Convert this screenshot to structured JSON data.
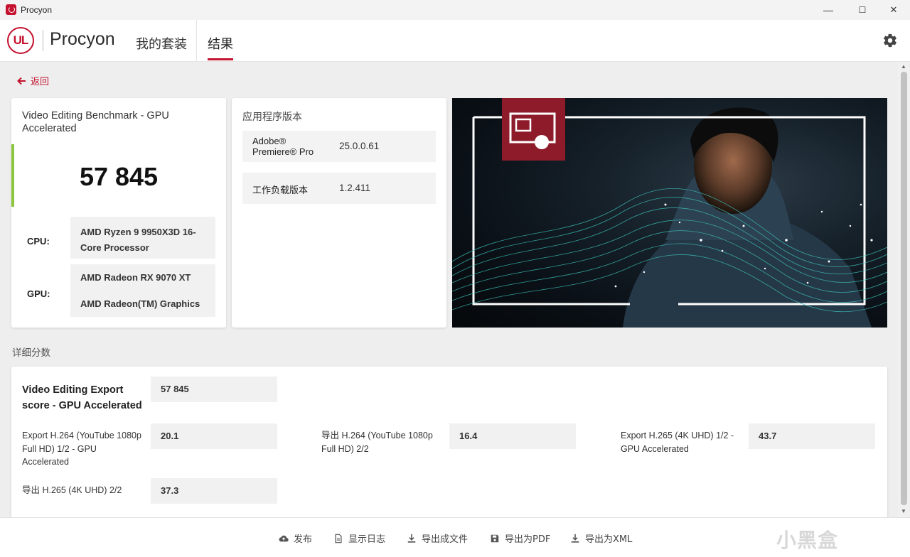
{
  "window": {
    "title": "Procyon",
    "minimize": "—",
    "maximize": "☐",
    "close": "✕"
  },
  "header": {
    "logo_text": "UL",
    "brand": "Procyon",
    "tabs": [
      {
        "label": "我的套装",
        "active": false
      },
      {
        "label": "结果",
        "active": true
      }
    ],
    "accent_color": "#c4122f"
  },
  "back": {
    "label": "返回"
  },
  "score_card": {
    "title": "Video Editing Benchmark - GPU Accelerated",
    "score": "57 845",
    "score_bar_color": "#8cc63f",
    "cpu_label": "CPU:",
    "cpu_value": "AMD Ryzen 9 9950X3D 16-Core Processor",
    "gpu_label": "GPU:",
    "gpu_values": [
      "AMD Radeon RX 9070 XT",
      "AMD Radeon(TM) Graphics"
    ]
  },
  "version_card": {
    "title": "应用程序版本",
    "rows": [
      {
        "key": "Adobe® Premiere® Pro",
        "value": "25.0.0.61"
      },
      {
        "key": "工作负载版本",
        "value": "1.2.411"
      }
    ]
  },
  "details": {
    "section_label": "详细分数",
    "main": {
      "label": "Video Editing Export score - GPU Accelerated",
      "value": "57 845"
    },
    "items": [
      {
        "label": "Export H.264 (YouTube 1080p Full HD) 1/2 - GPU Accelerated",
        "value": "20.1"
      },
      {
        "label": "导出 H.264 (YouTube 1080p Full HD) 2/2",
        "value": "16.4"
      },
      {
        "label": "Export H.265 (4K UHD) 1/2 - GPU Accelerated",
        "value": "43.7"
      },
      {
        "label": "导出 H.265 (4K UHD) 2/2",
        "value": "37.3"
      }
    ]
  },
  "footer": {
    "buttons": [
      {
        "label": "发布",
        "icon": "cloud-upload-icon"
      },
      {
        "label": "显示日志",
        "icon": "document-icon"
      },
      {
        "label": "导出成文件",
        "icon": "download-icon"
      },
      {
        "label": "导出为PDF",
        "icon": "save-icon"
      },
      {
        "label": "导出为XML",
        "icon": "download-icon"
      }
    ],
    "watermark": "小黑盒"
  }
}
